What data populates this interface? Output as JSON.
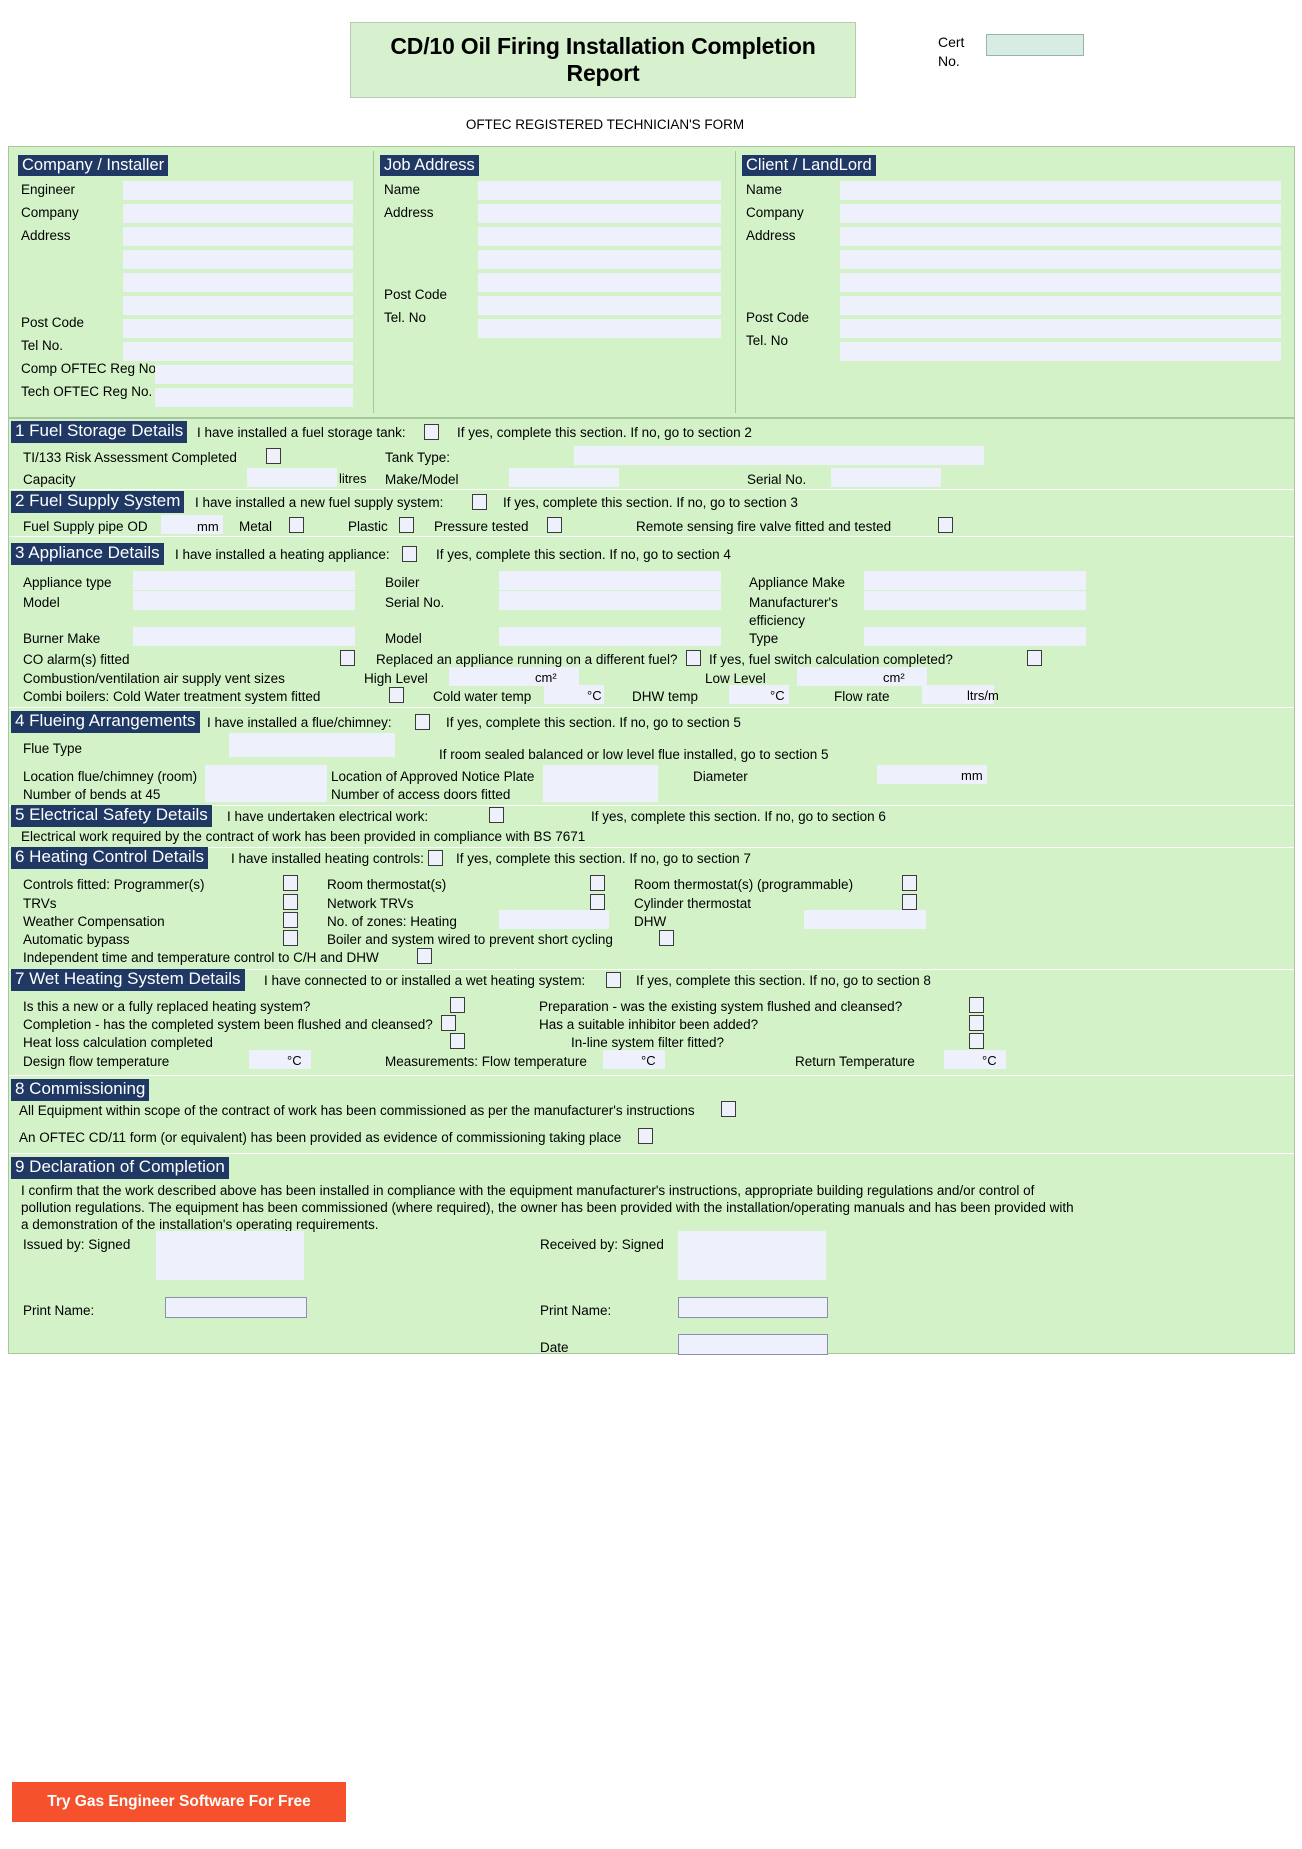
{
  "header": {
    "title": "CD/10 Oil Firing Installation Completion Report",
    "cert_label": "Cert No.",
    "cert_value": "",
    "subtitle": "OFTEC REGISTERED TECHNICIAN'S FORM"
  },
  "panels": {
    "company": {
      "heading": "Company / Installer",
      "labels": [
        "Engineer",
        "Company",
        "Address",
        "Post Code",
        "Tel No.",
        "Comp OFTEC Reg No.",
        "Tech OFTEC Reg No."
      ]
    },
    "job": {
      "heading": "Job Address",
      "labels": [
        "Name",
        "Address",
        "Post Code",
        "Tel. No"
      ]
    },
    "client": {
      "heading": "Client / LandLord",
      "labels": [
        "Name",
        "Company",
        "Address",
        "Post Code",
        "Tel. No"
      ]
    }
  },
  "sections": {
    "s1": {
      "heading": "1 Fuel Storage Details",
      "intro": "I have installed a fuel storage tank:",
      "ifyes": "If yes, complete this section. If no, go to section 2",
      "risk": "TI/133 Risk Assessment Completed",
      "tank_type": "Tank Type:",
      "capacity": "Capacity",
      "litres": "litres",
      "make_model": "Make/Model",
      "serial": "Serial No."
    },
    "s2": {
      "heading": "2 Fuel Supply System",
      "intro": "I have installed a new fuel supply system:",
      "ifyes": "If yes, complete this section. If no, go to section 3",
      "pipe_od": "Fuel Supply pipe OD",
      "mm": "mm",
      "metal": "Metal",
      "plastic": "Plastic",
      "pressure": "Pressure tested",
      "remote": "Remote sensing fire valve fitted and tested"
    },
    "s3": {
      "heading": "3 Appliance Details",
      "intro": "I have installed a heating appliance:",
      "ifyes": "If yes, complete this section. If no, go to section 4",
      "appliance_type": "Appliance type",
      "boiler": "Boiler",
      "appliance_make": "Appliance Make",
      "model": "Model",
      "serial_no": "Serial No.",
      "manuf_eff_1": "Manufacturer's",
      "manuf_eff_2": "efficiency",
      "burner_make": "Burner Make",
      "model2": "Model",
      "type": "Type",
      "co_alarm": "CO alarm(s) fitted",
      "replaced": "Replaced an appliance running on a different fuel?",
      "fuel_switch": "If yes, fuel switch calculation completed?",
      "vent_sizes": "Combustion/ventilation air supply vent sizes",
      "high_level": "High Level",
      "cm2": "cm²",
      "low_level": "Low Level",
      "combi": "Combi boilers: Cold Water treatment system fitted",
      "cold_water_temp": "Cold water temp",
      "degc": "°C",
      "dhw_temp": "DHW temp",
      "flow_rate": "Flow rate",
      "ltrsm": "ltrs/m"
    },
    "s4": {
      "heading": "4 Flueing Arrangements",
      "intro": "I have installed a flue/chimney:",
      "ifyes": "If yes, complete this section. If no, go to section 5",
      "flue_type": "Flue Type",
      "roomsealed": "If room sealed balanced or low level flue installed, go to section 5",
      "location_flue": "Location flue/chimney (room)",
      "location_plate": "Location of Approved Notice Plate",
      "diameter": "Diameter",
      "mm": "mm",
      "bends": "Number of bends at 45",
      "access_doors": "Number of access doors fitted"
    },
    "s5": {
      "heading": "5 Electrical Safety Details",
      "intro": "I have undertaken electrical work:",
      "ifyes": "If yes, complete this section. If no, go to section 6",
      "compliance": "Electrical work required by the contract of work has been provided in compliance with BS 7671"
    },
    "s6": {
      "heading": "6 Heating Control Details",
      "intro": "I have installed heating controls:",
      "ifyes": "If yes, complete this section. If no, go to section 7",
      "programmers": "Controls fitted: Programmer(s)",
      "room_stat": "Room thermostat(s)",
      "room_stat_prog": "Room thermostat(s) (programmable)",
      "trvs": "TRVs",
      "network_trvs": "Network TRVs",
      "cylinder_stat": "Cylinder thermostat",
      "weather_comp": "Weather Compensation",
      "zones_heating": "No. of zones: Heating",
      "dhw": "DHW",
      "auto_bypass": "Automatic bypass",
      "wired": "Boiler and system wired to prevent short cycling",
      "independent": "Independent time and temperature control to C/H and DHW"
    },
    "s7": {
      "heading": "7 Wet Heating System Details",
      "intro": "I have connected to or installed a wet heating system:",
      "ifyes": "If yes, complete this section. If no, go to section 8",
      "new_or_replaced": "Is this a new or a fully replaced heating system?",
      "preparation": "Preparation - was the existing system flushed and cleansed?",
      "completion": "Completion - has the completed system been flushed and cleansed?",
      "inhibitor": "Has a suitable inhibitor been added?",
      "heat_loss": "Heat loss calculation completed",
      "inline_filter": "In-line system filter fitted?",
      "design_flow": "Design flow temperature",
      "degc": "°C",
      "measure_flow": "Measurements: Flow temperature",
      "return_temp": "Return Temperature"
    },
    "s8": {
      "heading": "8 Commissioning",
      "line1": "All Equipment within scope of the contract of work has been commissioned as per the manufacturer's instructions",
      "line2": "An OFTEC CD/11 form (or equivalent) has been provided as evidence of commissioning taking place"
    },
    "s9": {
      "heading": "9 Declaration of Completion",
      "text": "I confirm that the work described above has been installed in compliance with the equipment manufacturer's instructions, appropriate building regulations and/or control of pollution regulations. The equipment has been commissioned (where required), the owner has been provided with the installation/operating manuals and has been provided with a demonstration of the installation's operating requirements.",
      "issued_by": "Issued by: Signed",
      "received_by": "Received by: Signed",
      "print_name_left": "Print Name:",
      "print_name_right": "Print Name:",
      "date": "Date"
    }
  },
  "footer": {
    "cta": "Try Gas Engineer Software For Free"
  },
  "colors": {
    "page_green": "#d3f2c8",
    "heading_navy": "#1f3864",
    "field_blue": "#eef1fb",
    "cta_orange": "#f4512c"
  }
}
